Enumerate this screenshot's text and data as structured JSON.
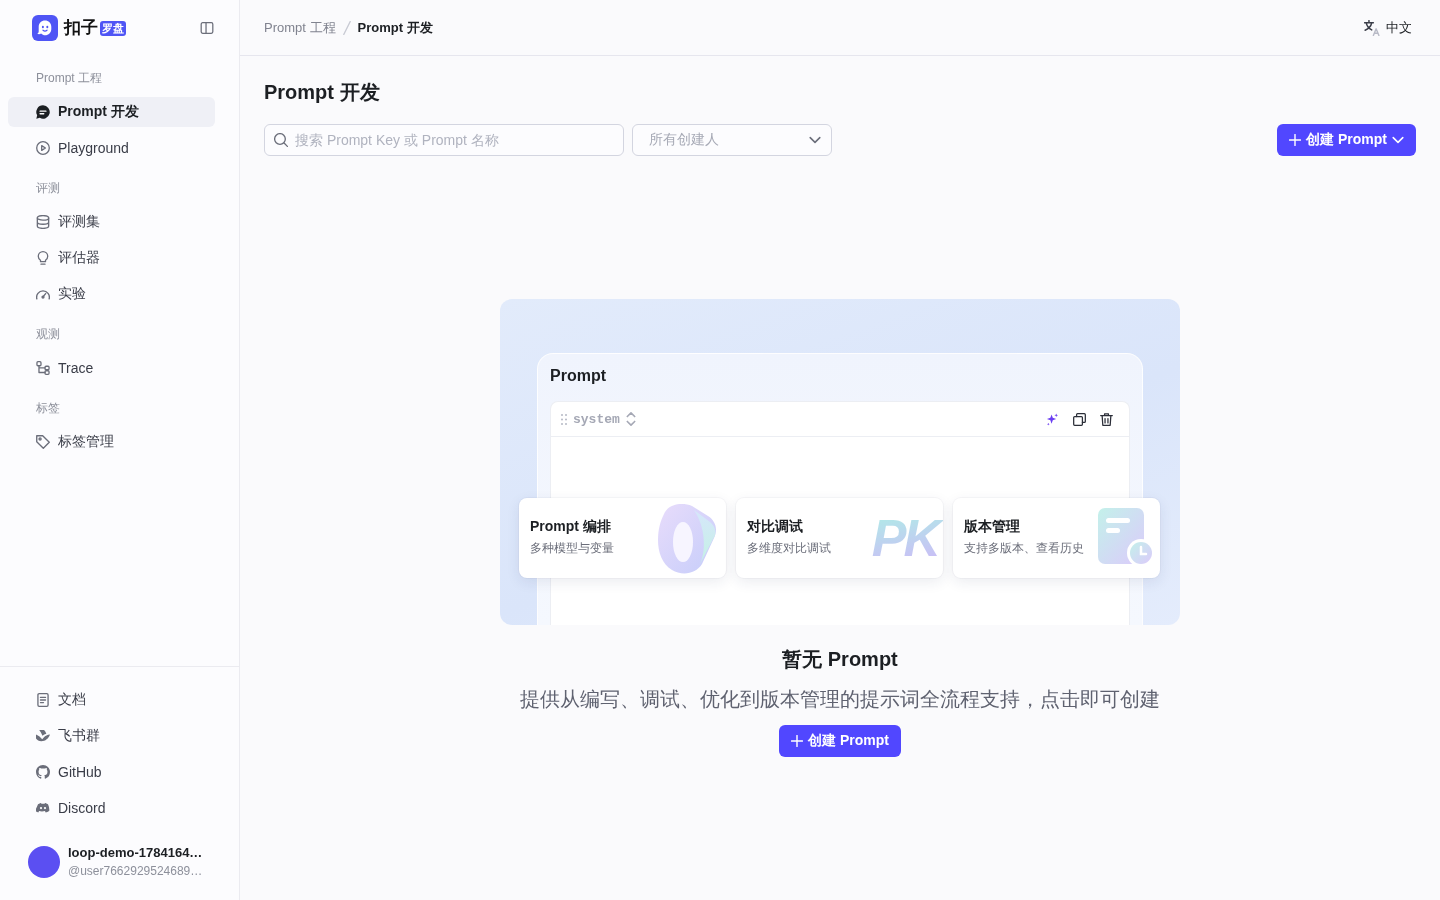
{
  "sidebar": {
    "brand": {
      "name": "扣子",
      "badge": "罗盘"
    },
    "groups": [
      {
        "title": "Prompt 工程",
        "items": [
          {
            "label": "Prompt 开发",
            "selected": true
          },
          {
            "label": "Playground",
            "selected": false
          }
        ]
      },
      {
        "title": "评测",
        "items": [
          {
            "label": "评测集",
            "selected": false
          },
          {
            "label": "评估器",
            "selected": false
          },
          {
            "label": "实验",
            "selected": false
          }
        ]
      },
      {
        "title": "观测",
        "items": [
          {
            "label": "Trace",
            "selected": false
          }
        ]
      },
      {
        "title": "标签",
        "items": [
          {
            "label": "标签管理",
            "selected": false
          }
        ]
      }
    ],
    "links": [
      {
        "label": "文档"
      },
      {
        "label": "飞书群"
      },
      {
        "label": "GitHub"
      },
      {
        "label": "Discord"
      }
    ],
    "user": {
      "name": "loop-demo-1784164…",
      "handle": "@user7662929524689…"
    }
  },
  "header": {
    "breadcrumb": [
      "Prompt 工程",
      "Prompt 开发"
    ],
    "language": "中文"
  },
  "page": {
    "title": "Prompt 开发",
    "search": {
      "placeholder": "搜索 Prompt Key 或 Prompt 名称"
    },
    "creator_filter": {
      "placeholder": "所有创建人"
    },
    "create_button": "创建 Prompt"
  },
  "empty_state": {
    "illustration": {
      "title": "Prompt",
      "role": "system",
      "features": [
        {
          "kind": "shape",
          "title": "Prompt 编排",
          "subtitle": "多种模型与变量"
        },
        {
          "kind": "lettering",
          "title": "对比调试",
          "subtitle": "多维度对比调试",
          "art_text": "PK"
        },
        {
          "kind": "document",
          "title": "版本管理",
          "subtitle": "支持多版本、查看历史"
        }
      ]
    },
    "title": "暂无 Prompt",
    "description": "提供从编写、调试、优化到版本管理的提示词全流程支持，点击即可创建",
    "button": "创建 Prompt"
  }
}
